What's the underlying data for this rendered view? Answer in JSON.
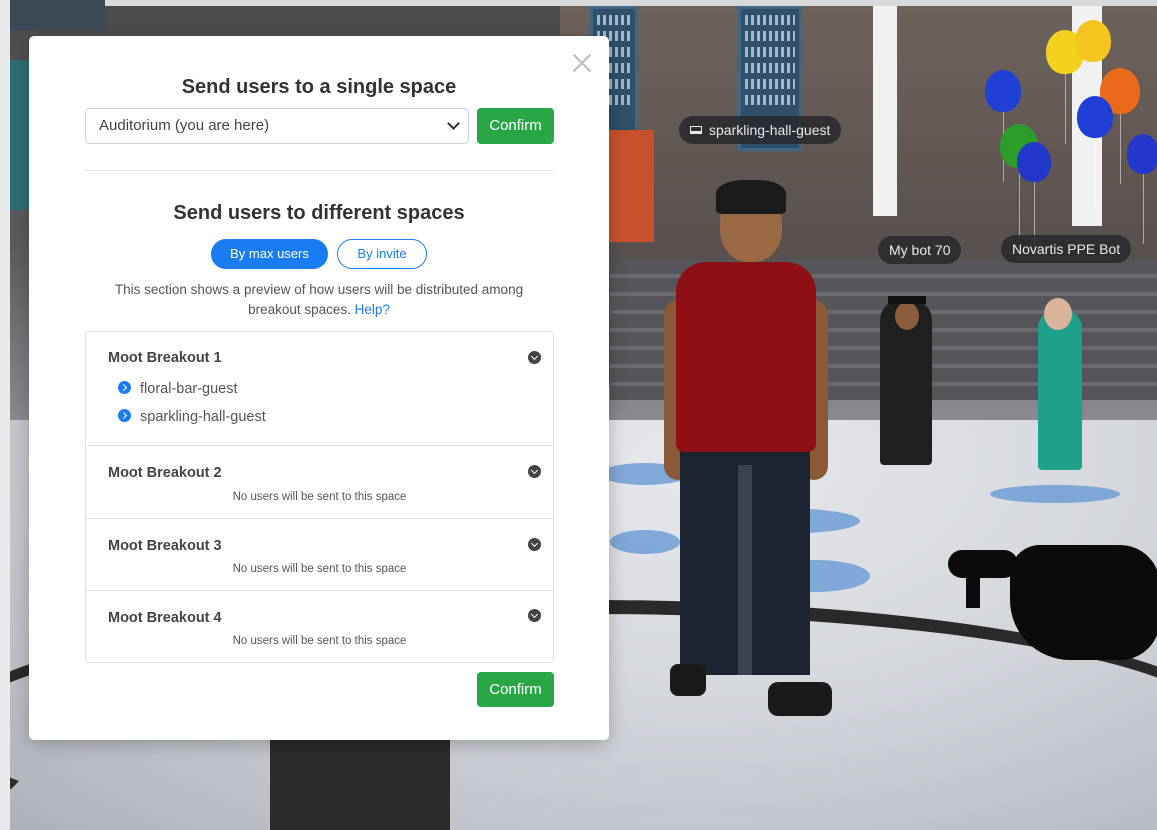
{
  "scene": {
    "nametags": {
      "sparkling": "sparkling-hall-guest",
      "bot70": "My bot 70",
      "novartis": "Novartis PPE Bot"
    }
  },
  "modal": {
    "single_space_heading": "Send users to a single space",
    "space_select_value": "Auditorium (you are here)",
    "confirm_label": "Confirm",
    "different_spaces_heading": "Send users to different spaces",
    "tabs": {
      "by_max_users": "By max users",
      "by_invite": "By invite"
    },
    "description": "This section shows a preview of how users will be distributed among breakout spaces.",
    "help_link": "Help?",
    "breakouts": [
      {
        "title": "Moot Breakout 1",
        "users": [
          "floral-bar-guest",
          "sparkling-hall-guest"
        ]
      },
      {
        "title": "Moot Breakout 2",
        "empty_note": "No users will be sent to this space"
      },
      {
        "title": "Moot Breakout 3",
        "empty_note": "No users will be sent to this space"
      },
      {
        "title": "Moot Breakout 4",
        "empty_note": "No users will be sent to this space"
      }
    ],
    "bottom_confirm_label": "Confirm"
  },
  "colors": {
    "primary": "#1a7cf2",
    "success": "#28a745"
  }
}
